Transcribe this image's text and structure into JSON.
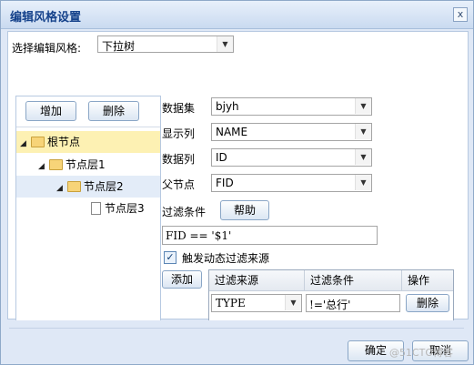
{
  "dialog": {
    "title": "编辑风格设置",
    "close_glyph": "x"
  },
  "style_selector": {
    "label": "选择编辑风格:",
    "value": "下拉树"
  },
  "tree_panel": {
    "add_label": "增加",
    "delete_label": "删除",
    "nodes": [
      {
        "label": "根节点",
        "selected": true
      },
      {
        "label": "节点层1"
      },
      {
        "label": "节点层2",
        "selected_secondary": true
      },
      {
        "label": "节点层3"
      }
    ]
  },
  "form": {
    "dataset_label": "数据集",
    "dataset_value": "bjyh",
    "display_col_label": "显示列",
    "display_col_value": "NAME",
    "data_col_label": "数据列",
    "data_col_value": "ID",
    "parent_label": "父节点",
    "parent_value": "FID",
    "filter_label": "过滤条件",
    "help_label": "帮助",
    "filter_value": "FID == '$1'",
    "trigger_label": "触发动态过滤来源",
    "trigger_checked": true
  },
  "filter_grid": {
    "add_label": "添加",
    "headers": [
      "过滤来源",
      "过滤条件",
      "操作"
    ],
    "rows": [
      {
        "source": "TYPE",
        "condition": "!='总行'",
        "action": "删除"
      }
    ]
  },
  "footer": {
    "ok_label": "确定",
    "cancel_label": "取消",
    "watermark": "@51CTO博客"
  }
}
